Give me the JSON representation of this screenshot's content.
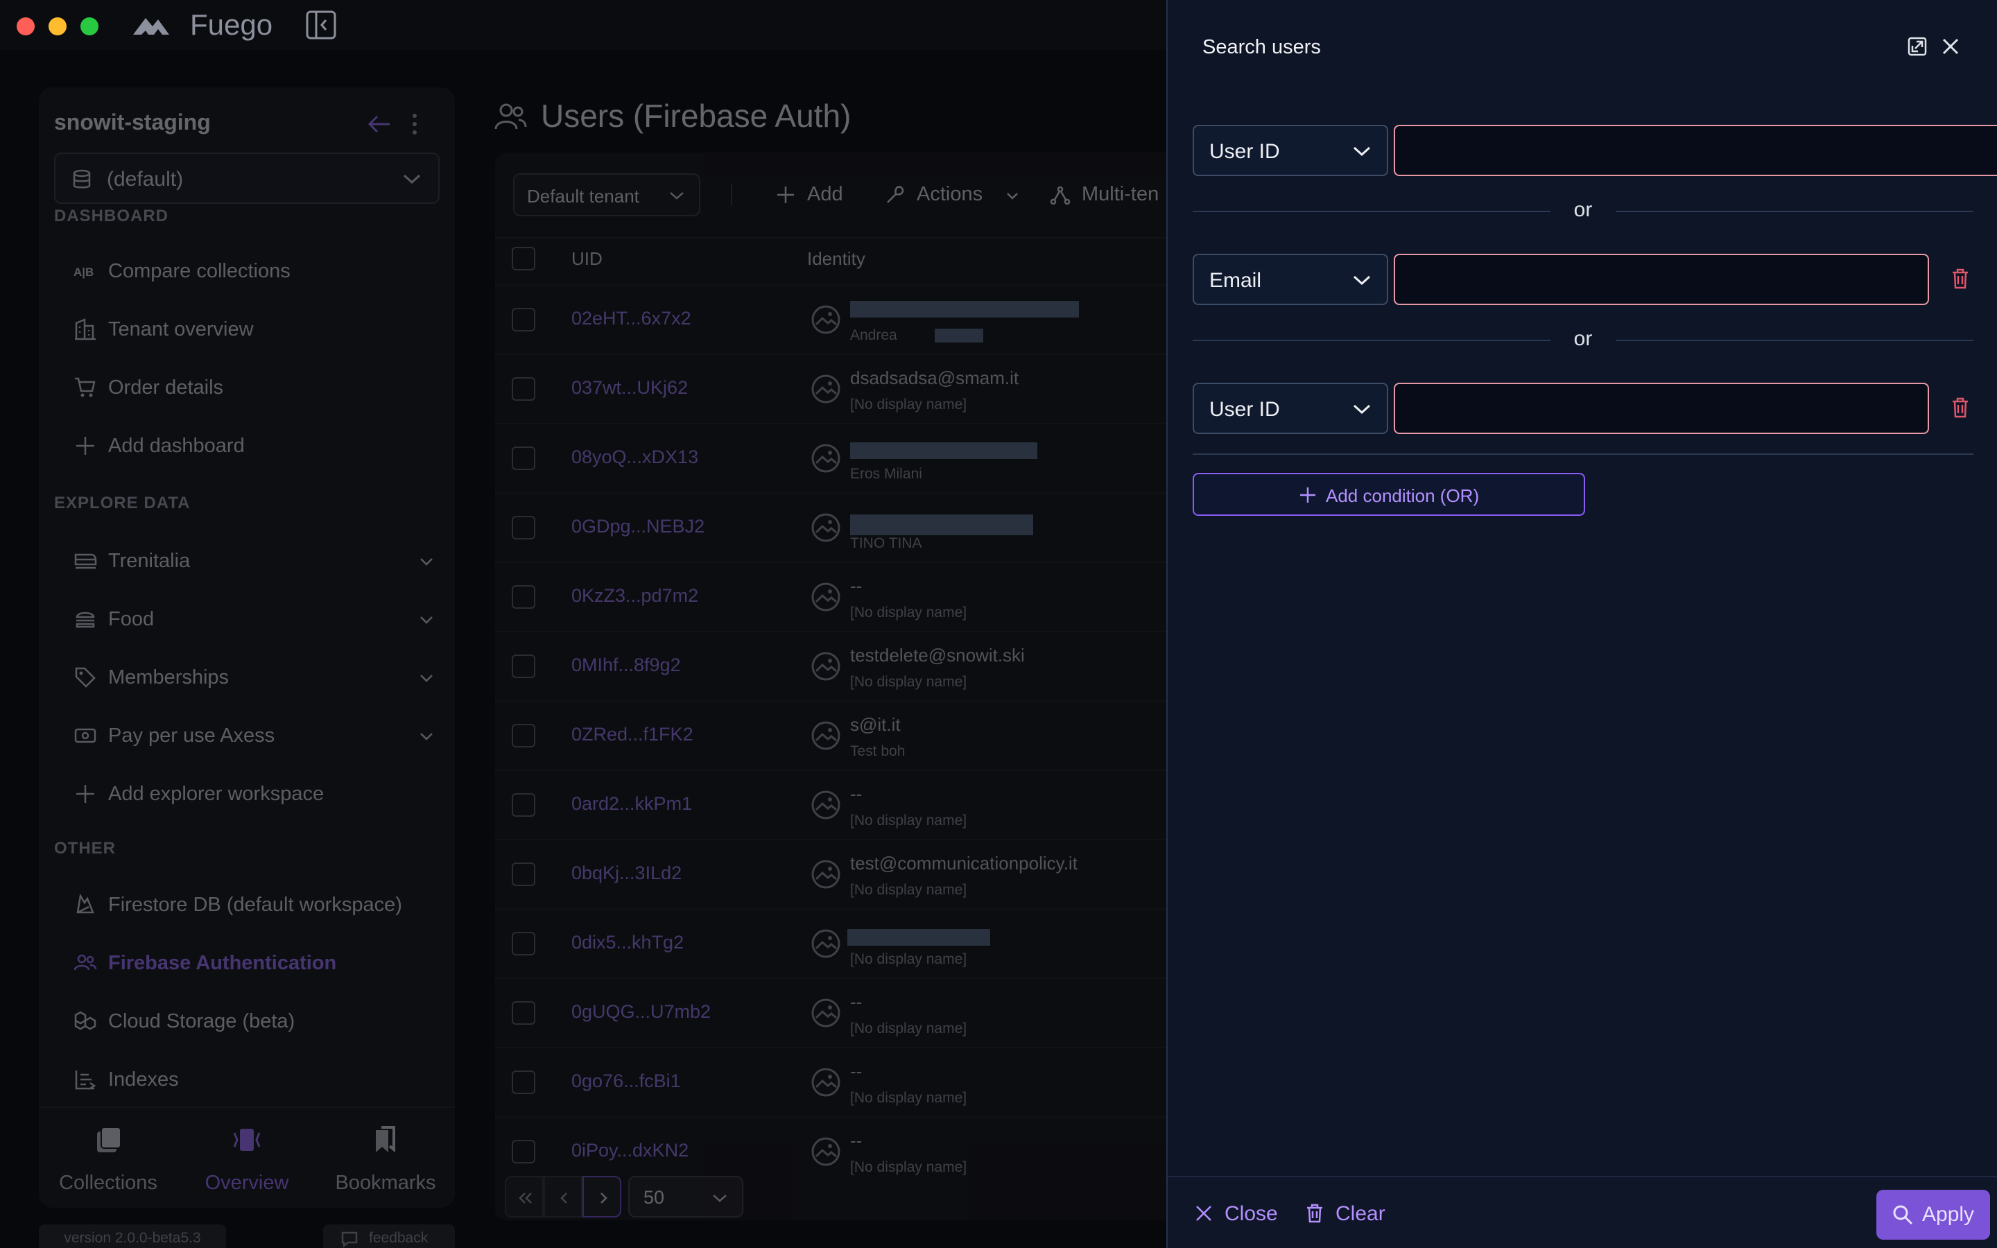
{
  "app": {
    "name": "Fuego"
  },
  "sidebar": {
    "project": "snowit-staging",
    "database": "(default)",
    "sections": {
      "dashboard": "DASHBOARD",
      "explore": "EXPLORE DATA",
      "other": "OTHER"
    },
    "dashboard_items": [
      {
        "label": "Compare collections",
        "icon": "compare-icon"
      },
      {
        "label": "Tenant overview",
        "icon": "building-icon"
      },
      {
        "label": "Order details",
        "icon": "cart-icon"
      },
      {
        "label": "Add dashboard",
        "icon": "plus-icon"
      }
    ],
    "explore_items": [
      {
        "label": "Trenitalia",
        "icon": "train-icon"
      },
      {
        "label": "Food",
        "icon": "burger-icon"
      },
      {
        "label": "Memberships",
        "icon": "tags-icon"
      },
      {
        "label": "Pay per use Axess",
        "icon": "ticket-icon"
      },
      {
        "label": "Add explorer workspace",
        "icon": "plus-icon"
      }
    ],
    "other_items": [
      {
        "label": "Firestore DB (default workspace)",
        "icon": "firestore-icon"
      },
      {
        "label": "Firebase Authentication",
        "icon": "users-icon",
        "active": true
      },
      {
        "label": "Cloud Storage (beta)",
        "icon": "boxes-icon"
      },
      {
        "label": "Indexes",
        "icon": "index-icon"
      }
    ],
    "bottom_tabs": [
      {
        "label": "Collections",
        "icon": "collections-icon"
      },
      {
        "label": "Overview",
        "icon": "overview-icon",
        "active": true
      },
      {
        "label": "Bookmarks",
        "icon": "bookmarks-icon"
      }
    ],
    "version": "version 2.0.0-beta5.3",
    "feedback": "feedback"
  },
  "users_page": {
    "title": "Users (Firebase Auth)",
    "tenant": "Default tenant",
    "toolbar": {
      "add": "Add",
      "actions": "Actions",
      "multi_tenant": "Multi-ten"
    },
    "columns": {
      "uid": "UID",
      "identity": "Identity"
    },
    "rows": [
      {
        "uid": "02eHT...6x7x2",
        "identity": "",
        "sub": "Andrea"
      },
      {
        "uid": "037wt...UKj62",
        "identity": "dsadsadsa@smam.it",
        "sub": "[No display name]"
      },
      {
        "uid": "08yoQ...xDX13",
        "identity": "",
        "sub": "Eros Milani"
      },
      {
        "uid": "0GDpg...NEBJ2",
        "identity": "",
        "sub": "TINO TINA"
      },
      {
        "uid": "0KzZ3...pd7m2",
        "identity": "--",
        "sub": "[No display name]"
      },
      {
        "uid": "0MIhf...8f9g2",
        "identity": "testdelete@snowit.ski",
        "sub": "[No display name]"
      },
      {
        "uid": "0ZRed...f1FK2",
        "identity": "s@it.it",
        "sub": "Test boh"
      },
      {
        "uid": "0ard2...kkPm1",
        "identity": "--",
        "sub": "[No display name]"
      },
      {
        "uid": "0bqKj...3ILd2",
        "identity": "test@communicationpolicy.it",
        "sub": "[No display name]"
      },
      {
        "uid": "0dix5...khTg2",
        "identity": "",
        "sub": "[No display name]"
      },
      {
        "uid": "0gUQG...U7mb2",
        "identity": "--",
        "sub": "[No display name]"
      },
      {
        "uid": "0go76...fcBi1",
        "identity": "--",
        "sub": "[No display name]"
      },
      {
        "uid": "0iPoy...dxKN2",
        "identity": "--",
        "sub": "[No display name]"
      }
    ],
    "page_size": "50"
  },
  "search_drawer": {
    "title": "Search users",
    "conditions": [
      {
        "field": "User ID",
        "value": ""
      },
      {
        "field": "Email",
        "value": ""
      },
      {
        "field": "User ID",
        "value": ""
      }
    ],
    "or_label": "or",
    "add_condition": "Add condition (OR)",
    "footer": {
      "close": "Close",
      "clear": "Clear",
      "apply": "Apply"
    }
  },
  "colors": {
    "accent": "#8b5cf6",
    "accent_text": "#b490ff",
    "input_border": "#e79aa6",
    "danger": "#e0566a",
    "drawer_bg": "#0d1526"
  }
}
